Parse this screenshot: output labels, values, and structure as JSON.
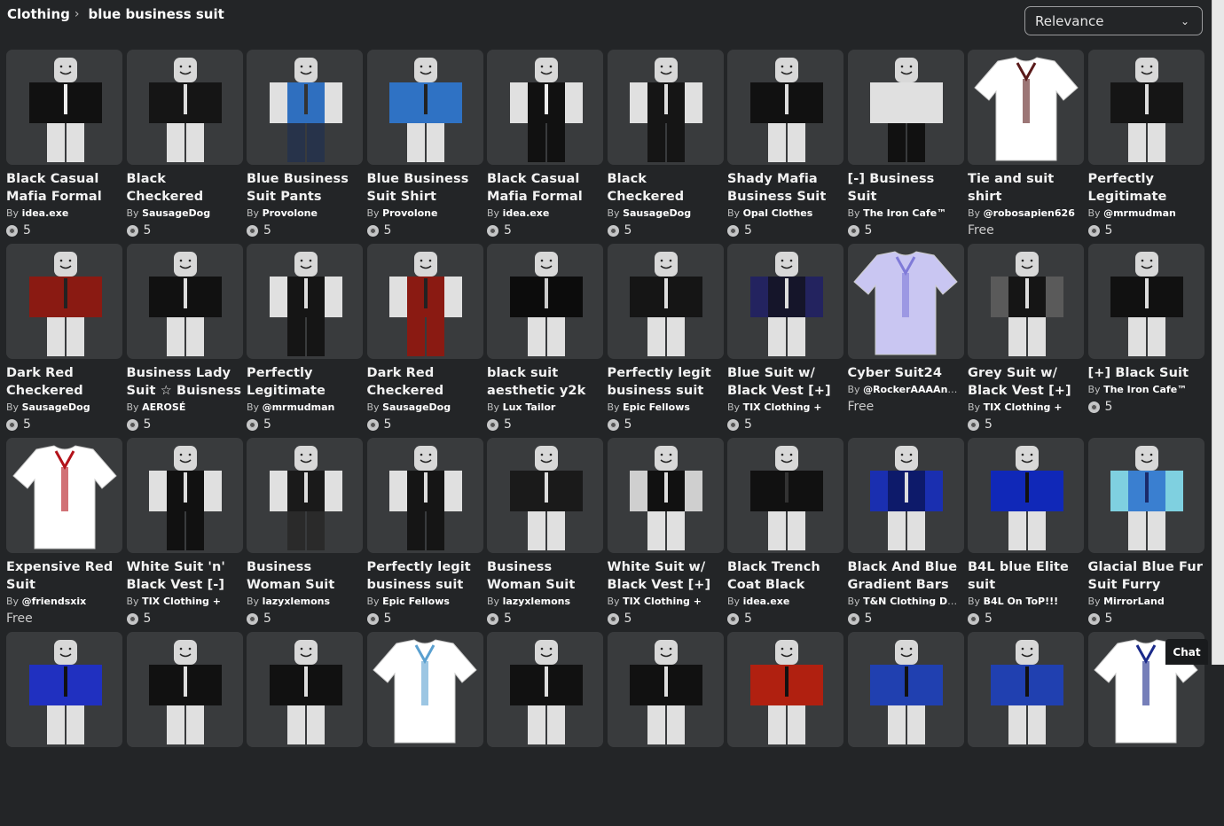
{
  "breadcrumb": {
    "category": "Clothing",
    "separator": "›",
    "query": "blue business suit"
  },
  "sort": {
    "selected": "Relevance"
  },
  "by_label": "By",
  "items": [
    {
      "title": "Black Casual Mafia Formal",
      "creator": "idea.exe",
      "price": "5",
      "thumb": {
        "kind": "avatar",
        "torso": "#111111",
        "arms": "#111111",
        "legs": "#e0e0e0",
        "tie": "#eeeeee"
      }
    },
    {
      "title": "Black Checkered Formal Business",
      "creator": "SausageDog",
      "price": "5",
      "thumb": {
        "kind": "avatar",
        "torso": "#151515",
        "arms": "#151515",
        "legs": "#e0e0e0",
        "tie": "#dddddd"
      }
    },
    {
      "title": "Blue Business Suit Pants",
      "creator": "Provolone",
      "price": "5",
      "thumb": {
        "kind": "avatar",
        "torso": "#2f6fbf",
        "arms": "#e0e0e0",
        "legs": "#27334a",
        "tie": "#333333"
      }
    },
    {
      "title": "Blue Business Suit Shirt",
      "creator": "Provolone",
      "price": "5",
      "thumb": {
        "kind": "avatar",
        "torso": "#2f72c4",
        "arms": "#2f72c4",
        "legs": "#e0e0e0",
        "tie": "#222222"
      }
    },
    {
      "title": "Black Casual Mafia Formal",
      "creator": "idea.exe",
      "price": "5",
      "thumb": {
        "kind": "avatar",
        "torso": "#111111",
        "arms": "#e0e0e0",
        "legs": "#111111",
        "tie": "#eeeeee"
      }
    },
    {
      "title": "Black Checkered Formal Business",
      "creator": "SausageDog",
      "price": "5",
      "thumb": {
        "kind": "avatar",
        "torso": "#151515",
        "arms": "#e0e0e0",
        "legs": "#151515",
        "tie": "#dddddd"
      }
    },
    {
      "title": "Shady Mafia Business Suit",
      "creator": "Opal Clothes",
      "price": "5",
      "thumb": {
        "kind": "avatar",
        "torso": "#111111",
        "arms": "#111111",
        "legs": "#e0e0e0",
        "tie": "#dddddd"
      }
    },
    {
      "title": "[-] Business Suit",
      "creator": "The Iron Cafe™",
      "price": "5",
      "thumb": {
        "kind": "avatar",
        "torso": "#e0e0e0",
        "arms": "#e0e0e0",
        "legs": "#111111",
        "tie": "#e0e0e0"
      }
    },
    {
      "title": "Tie and suit shirt",
      "creator": "@robosapien626",
      "price": "Free",
      "thumb": {
        "kind": "shirt",
        "shirt": "#ffffff",
        "accent": "#5a1a1a"
      }
    },
    {
      "title": "Perfectly Legitimate",
      "creator": "@mrmudman",
      "price": "5",
      "thumb": {
        "kind": "avatar",
        "torso": "#151515",
        "arms": "#151515",
        "legs": "#e0e0e0",
        "tie": "#dddddd"
      }
    },
    {
      "title": "Dark Red Checkered",
      "creator": "SausageDog",
      "price": "5",
      "thumb": {
        "kind": "avatar",
        "torso": "#8a1a12",
        "arms": "#8a1a12",
        "legs": "#e0e0e0",
        "tie": "#222222"
      }
    },
    {
      "title": "Business Lady Suit ☆ Buisness",
      "creator": "AEROSÉ",
      "price": "5",
      "thumb": {
        "kind": "avatar",
        "torso": "#111111",
        "arms": "#111111",
        "legs": "#e0e0e0",
        "tie": "#dddddd"
      }
    },
    {
      "title": "Perfectly Legitimate",
      "creator": "@mrmudman",
      "price": "5",
      "thumb": {
        "kind": "avatar",
        "torso": "#151515",
        "arms": "#e0e0e0",
        "legs": "#151515",
        "tie": "#dddddd"
      }
    },
    {
      "title": "Dark Red Checkered",
      "creator": "SausageDog",
      "price": "5",
      "thumb": {
        "kind": "avatar",
        "torso": "#8a1a12",
        "arms": "#e0e0e0",
        "legs": "#8a1a12",
        "tie": "#222222"
      }
    },
    {
      "title": "black suit aesthetic y2k",
      "creator": "Lux Tailor",
      "price": "5",
      "thumb": {
        "kind": "avatar",
        "torso": "#0c0c0c",
        "arms": "#0c0c0c",
        "legs": "#e0e0e0",
        "tie": "#cccccc"
      }
    },
    {
      "title": "Perfectly legit business suit",
      "creator": "Epic Fellows",
      "price": "5",
      "thumb": {
        "kind": "avatar",
        "torso": "#151515",
        "arms": "#151515",
        "legs": "#e0e0e0",
        "tie": "#dddddd"
      }
    },
    {
      "title": "Blue Suit w/ Black Vest [+]",
      "creator": "TIX Clothing +",
      "price": "5",
      "thumb": {
        "kind": "avatar",
        "torso": "#15152a",
        "arms": "#23235f",
        "legs": "#e0e0e0",
        "tie": "#dddddd"
      }
    },
    {
      "title": "Cyber Suit24",
      "creator": "@RockerAAAAnnnn",
      "price": "Free",
      "thumb": {
        "kind": "shirt",
        "shirt": "#c9c6f2",
        "accent": "#7f7ad8"
      }
    },
    {
      "title": "Grey Suit w/ Black Vest [+]",
      "creator": "TIX Clothing +",
      "price": "5",
      "thumb": {
        "kind": "avatar",
        "torso": "#151515",
        "arms": "#5a5a5a",
        "legs": "#e0e0e0",
        "tie": "#dddddd"
      }
    },
    {
      "title": "[+] Black Suit",
      "creator": "The Iron Cafe™",
      "price": "5",
      "thumb": {
        "kind": "avatar",
        "torso": "#111111",
        "arms": "#111111",
        "legs": "#e0e0e0",
        "tie": "#dddddd"
      }
    },
    {
      "title": "Expensive Red Suit",
      "creator": "@friendsxix",
      "price": "Free",
      "thumb": {
        "kind": "shirt",
        "shirt": "#ffffff",
        "accent": "#b3121a"
      }
    },
    {
      "title": "White Suit 'n' Black Vest [-]",
      "creator": "TIX Clothing +",
      "price": "5",
      "thumb": {
        "kind": "avatar",
        "torso": "#111111",
        "arms": "#e0e0e0",
        "legs": "#111111",
        "tie": "#dddddd"
      }
    },
    {
      "title": "Business Woman Suit",
      "creator": "lazyxlemons",
      "price": "5",
      "thumb": {
        "kind": "avatar",
        "torso": "#1a1a1a",
        "arms": "#e0e0e0",
        "legs": "#2a2a2a",
        "tie": "#dddddd"
      }
    },
    {
      "title": "Perfectly legit business suit",
      "creator": "Epic Fellows",
      "price": "5",
      "thumb": {
        "kind": "avatar",
        "torso": "#151515",
        "arms": "#e0e0e0",
        "legs": "#151515",
        "tie": "#dddddd"
      }
    },
    {
      "title": "Business Woman Suit [Shirt]",
      "creator": "lazyxlemons",
      "price": "5",
      "thumb": {
        "kind": "avatar",
        "torso": "#1a1a1a",
        "arms": "#1a1a1a",
        "legs": "#e0e0e0",
        "tie": "#dddddd"
      }
    },
    {
      "title": "White Suit w/ Black Vest [+]",
      "creator": "TIX Clothing +",
      "price": "5",
      "thumb": {
        "kind": "avatar",
        "torso": "#111111",
        "arms": "#cfcfcf",
        "legs": "#e0e0e0",
        "tie": "#dddddd"
      }
    },
    {
      "title": "Black Trench Coat Black",
      "creator": "idea.exe",
      "price": "5",
      "thumb": {
        "kind": "avatar",
        "torso": "#111111",
        "arms": "#111111",
        "legs": "#e0e0e0",
        "tie": "#333333"
      }
    },
    {
      "title": "Black And Blue Gradient Bars",
      "creator": "T&N Clothing Desi...",
      "price": "5",
      "thumb": {
        "kind": "avatar",
        "torso": "#0d1a6a",
        "arms": "#1a2fb0",
        "legs": "#e0e0e0",
        "tie": "#dddddd"
      }
    },
    {
      "title": "B4L blue Elite suit",
      "creator": "B4L On ToP!!!",
      "price": "5",
      "thumb": {
        "kind": "avatar",
        "torso": "#1028b8",
        "arms": "#1028b8",
        "legs": "#e0e0e0",
        "tie": "#111111"
      }
    },
    {
      "title": "Glacial Blue Fur Suit Furry Fursuit",
      "creator": "MirrorLand",
      "price": "5",
      "thumb": {
        "kind": "avatar",
        "torso": "#3a7fd0",
        "arms": "#7fd0e0",
        "legs": "#e0e0e0",
        "tie": "#1a2a6a"
      }
    }
  ],
  "partial_row": [
    {
      "thumb": {
        "kind": "avatar",
        "torso": "#2030c0",
        "arms": "#2030c0",
        "legs": "#e0e0e0",
        "tie": "#111111"
      }
    },
    {
      "thumb": {
        "kind": "avatar",
        "torso": "#111111",
        "arms": "#111111",
        "legs": "#e0e0e0",
        "tie": "#dddddd"
      }
    },
    {
      "thumb": {
        "kind": "avatar",
        "torso": "#111111",
        "arms": "#111111",
        "legs": "#e0e0e0",
        "tie": "#dddddd"
      }
    },
    {
      "thumb": {
        "kind": "shirt",
        "shirt": "#ffffff",
        "accent": "#5aa0d0"
      }
    },
    {
      "thumb": {
        "kind": "avatar",
        "torso": "#111111",
        "arms": "#111111",
        "legs": "#e0e0e0",
        "tie": "#dddddd"
      }
    },
    {
      "thumb": {
        "kind": "avatar",
        "torso": "#111111",
        "arms": "#111111",
        "legs": "#e0e0e0",
        "tie": "#dddddd"
      }
    },
    {
      "thumb": {
        "kind": "avatar",
        "torso": "#b02010",
        "arms": "#b02010",
        "legs": "#e0e0e0",
        "tie": "#111111"
      }
    },
    {
      "thumb": {
        "kind": "avatar",
        "torso": "#2040b0",
        "arms": "#2040b0",
        "legs": "#e0e0e0",
        "tie": "#111111"
      }
    },
    {
      "thumb": {
        "kind": "avatar",
        "torso": "#2040b0",
        "arms": "#2040b0",
        "legs": "#e0e0e0",
        "tie": "#111111"
      }
    },
    {
      "thumb": {
        "kind": "shirt",
        "shirt": "#ffffff",
        "accent": "#1a2a8a"
      }
    }
  ],
  "chat": {
    "label": "Chat"
  }
}
